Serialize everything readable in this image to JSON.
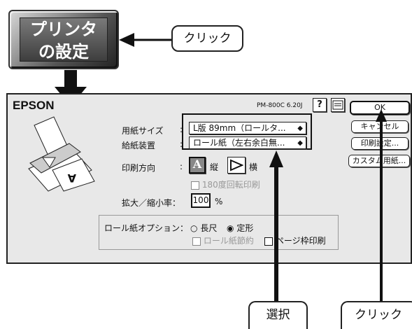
{
  "printer_button": {
    "line1": "プリンタ",
    "line2": "の設定"
  },
  "callouts": {
    "click_top": "クリック",
    "select": "選択",
    "click_bottom": "クリック"
  },
  "dialog": {
    "brand": "EPSON",
    "version": "PM-800C 6.20J",
    "help_icon": "?",
    "ok": "OK",
    "cancel": "キャンセル",
    "print_settings": "印刷設定...",
    "custom_paper": "カスタム用紙...",
    "paper_size_label": "用紙サイズ",
    "paper_size_value": "L版 89mm（ロールタ...",
    "feed_label": "給紙装置",
    "feed_value": "ロール紙（左右余白無...",
    "orientation_label": "印刷方向",
    "portrait": "縦",
    "landscape": "横",
    "rotate180": "180度回転印刷",
    "scale_label": "拡大／縮小率：",
    "scale_value": "100",
    "scale_unit": "%",
    "roll_options_label": "ロール紙オプション：",
    "long": "長尺",
    "fixed": "定形",
    "roll_save": "ロール紙節約",
    "page_frame": "ページ枠印刷",
    "colon": ":"
  }
}
